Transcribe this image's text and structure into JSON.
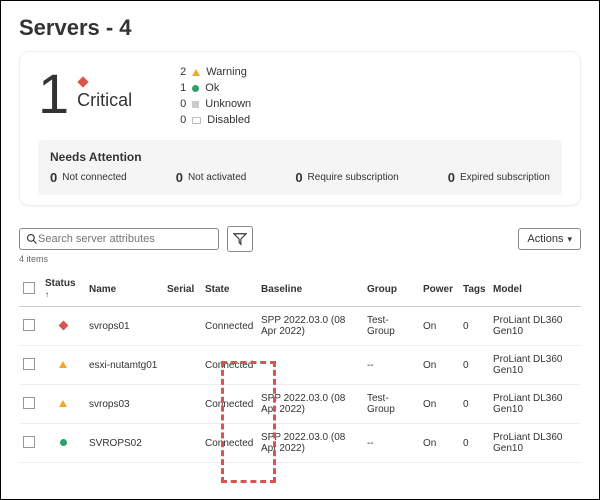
{
  "title": "Servers - 4",
  "summary": {
    "critical_count": "1",
    "critical_label": "Critical",
    "statuses": [
      {
        "count": "2",
        "label": "Warning",
        "kind": "warn"
      },
      {
        "count": "1",
        "label": "Ok",
        "kind": "ok"
      },
      {
        "count": "0",
        "label": "Unknown",
        "kind": "unk"
      },
      {
        "count": "0",
        "label": "Disabled",
        "kind": "dis"
      }
    ]
  },
  "needs": {
    "heading": "Needs Attention",
    "items": [
      {
        "count": "0",
        "label": "Not connected"
      },
      {
        "count": "0",
        "label": "Not activated"
      },
      {
        "count": "0",
        "label": "Require subscription"
      },
      {
        "count": "0",
        "label": "Expired subscription"
      }
    ]
  },
  "search": {
    "placeholder": "Search server attributes"
  },
  "actions_label": "Actions",
  "items_count_label": "4 items",
  "columns": {
    "status": "Status",
    "name": "Name",
    "serial": "Serial",
    "state": "State",
    "baseline": "Baseline",
    "group": "Group",
    "power": "Power",
    "tags": "Tags",
    "model": "Model"
  },
  "rows": [
    {
      "status": "critical",
      "name": "svrops01",
      "serial": "",
      "state": "Connected",
      "baseline": "SPP 2022.03.0 (08 Apr 2022)",
      "group": "Test-Group",
      "power": "On",
      "tags": "0",
      "model": "ProLiant DL360 Gen10"
    },
    {
      "status": "warn",
      "name": "esxi-nutamtg01",
      "serial": "",
      "state": "Connected",
      "baseline": "",
      "group": "--",
      "power": "On",
      "tags": "0",
      "model": "ProLiant DL360 Gen10"
    },
    {
      "status": "warn",
      "name": "svrops03",
      "serial": "",
      "state": "Connected",
      "baseline": "SPP 2022.03.0 (08 Apr 2022)",
      "group": "Test-Group",
      "power": "On",
      "tags": "0",
      "model": "ProLiant DL360 Gen10"
    },
    {
      "status": "ok",
      "name": "SVROPS02",
      "serial": "",
      "state": "Connected",
      "baseline": "SPP 2022.03.0 (08 Apr 2022)",
      "group": "--",
      "power": "On",
      "tags": "0",
      "model": "ProLiant DL360 Gen10"
    }
  ]
}
